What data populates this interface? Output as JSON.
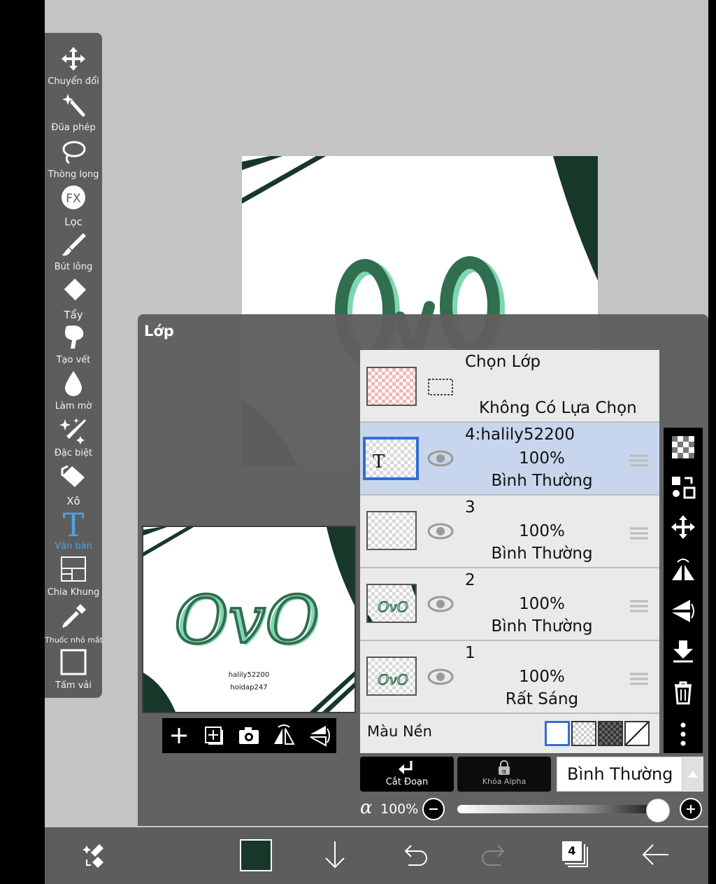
{
  "app": {
    "panel_title": "Lớp",
    "primary_color": "#173728"
  },
  "toolbar": [
    {
      "label": "Chuyển đổi",
      "icon": "move-icon"
    },
    {
      "label": "Đũa phép",
      "icon": "magic-wand-icon"
    },
    {
      "label": "Thòng lọng",
      "icon": "lasso-icon"
    },
    {
      "label": "Lọc",
      "icon": "fx-filter-icon"
    },
    {
      "label": "Bút lông",
      "icon": "brush-icon"
    },
    {
      "label": "Tẩy",
      "icon": "eraser-icon"
    },
    {
      "label": "Tạo vết",
      "icon": "smudge-icon"
    },
    {
      "label": "Làm mờ",
      "icon": "blur-drop-icon"
    },
    {
      "label": "Đặc biệt",
      "icon": "special-sparkle-icon"
    },
    {
      "label": "Xô",
      "icon": "bucket-icon"
    },
    {
      "label": "Văn bản",
      "icon": "text-icon",
      "active": true
    },
    {
      "label": "Chia Khung",
      "icon": "frame-divider-icon"
    },
    {
      "label": "Thuốc nhỏ mắt",
      "icon": "eyedropper-icon"
    },
    {
      "label": "Tấm vải",
      "icon": "canvas-icon"
    }
  ],
  "preview": {
    "art_text": "OvO",
    "caption_1": "halily52200",
    "caption_2": "hoidap247"
  },
  "selection_row": {
    "title": "Chọn Lớp",
    "subtitle": "Không Có Lựa Chọn"
  },
  "layers": [
    {
      "name": "4:halily52200",
      "opacity": "100%",
      "mode": "Bình Thường",
      "selected": true
    },
    {
      "name": "3",
      "opacity": "100%",
      "mode": "Bình Thường"
    },
    {
      "name": "2",
      "opacity": "100%",
      "mode": "Bình Thường"
    },
    {
      "name": "1",
      "opacity": "100%",
      "mode": "Rất Sáng"
    }
  ],
  "background_label": "Màu Nền",
  "controls": {
    "clip_label": "Cắt Đoạn",
    "alpha_lock_label": "Khóa Alpha",
    "blend_mode": "Bình Thường",
    "alpha_symbol": "α",
    "alpha_value": "100%",
    "opacity_fraction": 1.0
  },
  "bottom_bar": {
    "layer_count": "4"
  }
}
